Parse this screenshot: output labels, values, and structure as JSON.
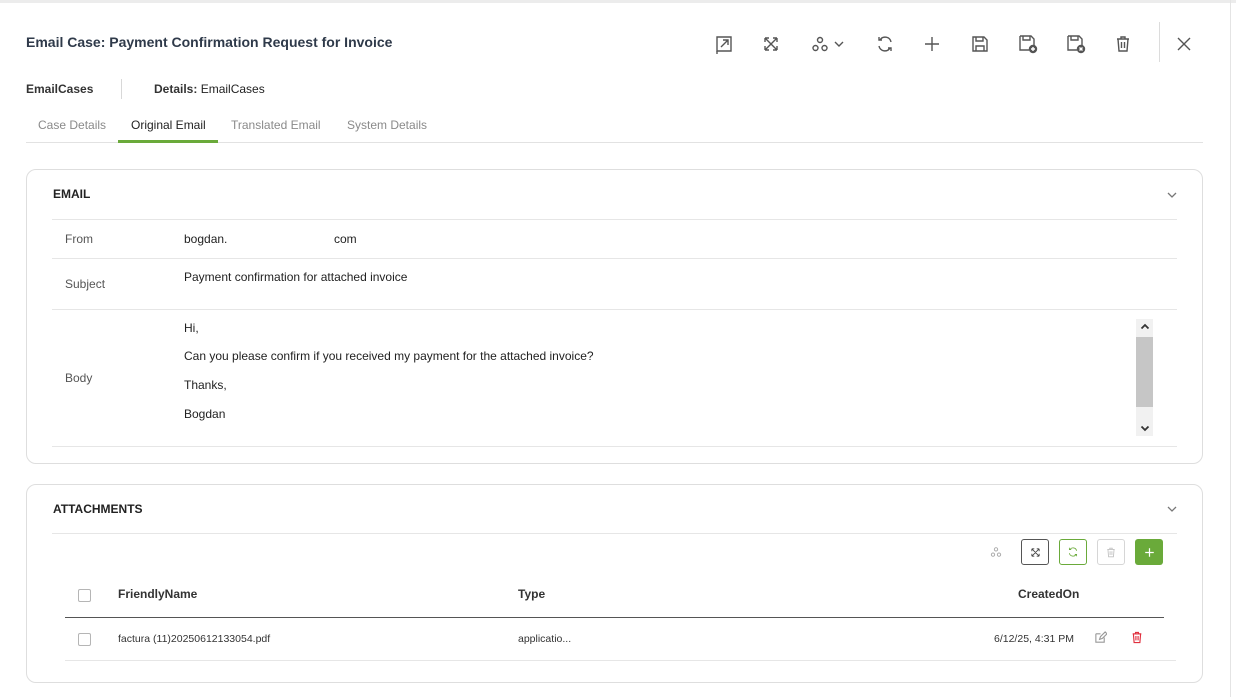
{
  "title": "Email Case: Payment Confirmation Request for Invoice",
  "toolbar": {
    "icons": [
      "open-in-new-icon",
      "fullscreen-icon",
      "workflow-icon",
      "refresh-icon",
      "add-icon",
      "save-icon",
      "save-new-icon",
      "save-close-icon",
      "delete-icon",
      "close-icon"
    ]
  },
  "breadcrumb": {
    "first": "EmailCases",
    "second_label": "Details:",
    "second_value": "EmailCases"
  },
  "tabs": [
    "Case Details",
    "Original Email",
    "Translated Email",
    "System Details"
  ],
  "active_tab": "Original Email",
  "email": {
    "section_title": "EMAIL",
    "from_label": "From",
    "from_value_start": "bogdan.",
    "from_value_end": "com",
    "subject_label": "Subject",
    "subject_value": "Payment confirmation for attached invoice",
    "body_label": "Body",
    "body_lines": [
      "Hi,",
      "Can you please confirm if you received my payment for the attached invoice?",
      "Thanks,",
      "Bogdan"
    ]
  },
  "attachments": {
    "section_title": "ATTACHMENTS",
    "columns": [
      "FriendlyName",
      "Type",
      "CreatedOn"
    ],
    "rows": [
      {
        "name": "factura (11)20250612133054.pdf",
        "type": "applicatio...",
        "created": "6/12/25, 4:31 PM"
      }
    ]
  },
  "colors": {
    "accent": "#6aaa3a",
    "delete": "#e0303f"
  }
}
